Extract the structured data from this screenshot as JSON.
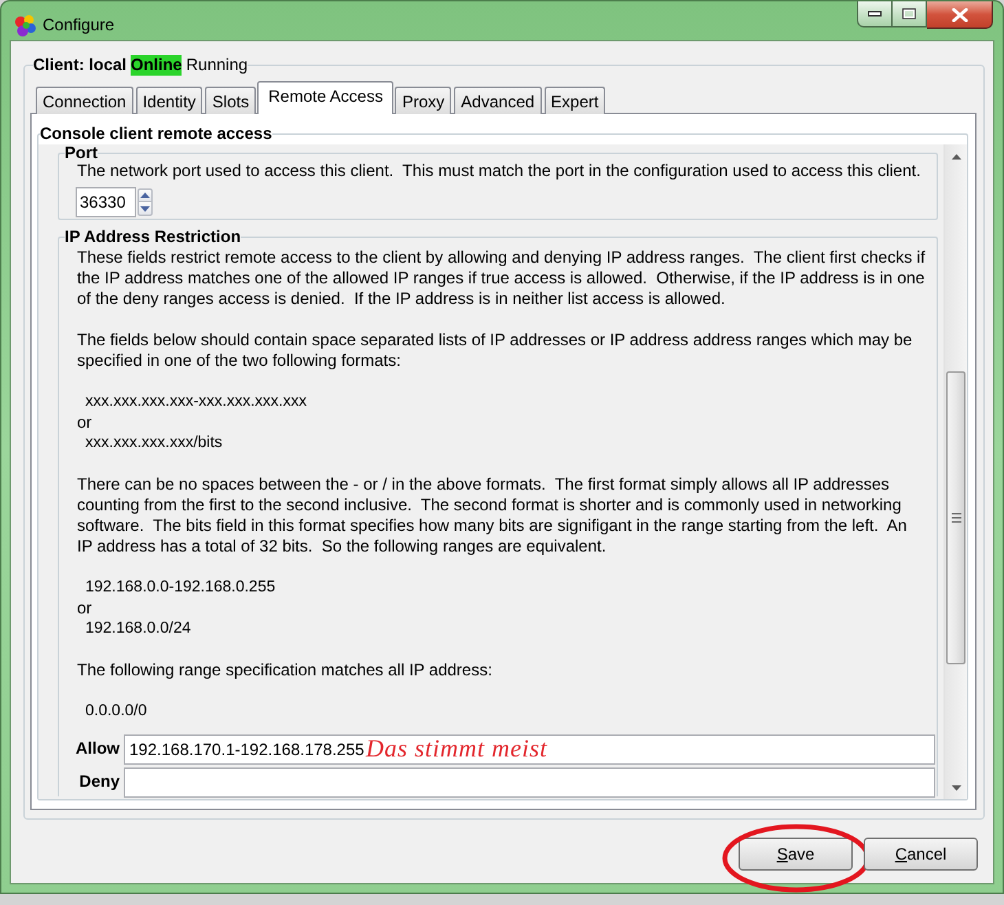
{
  "window": {
    "title": "Configure"
  },
  "client": {
    "label": "Client: local",
    "status": "Online",
    "online": true,
    "state": "Running"
  },
  "tabs": [
    {
      "label": "Connection",
      "selected": false
    },
    {
      "label": "Identity",
      "selected": false
    },
    {
      "label": "Slots",
      "selected": false
    },
    {
      "label": "Remote Access",
      "selected": true
    },
    {
      "label": "Proxy",
      "selected": false
    },
    {
      "label": "Advanced",
      "selected": false
    },
    {
      "label": "Expert",
      "selected": false
    }
  ],
  "remote_access": {
    "legend": "Console client remote access",
    "port": {
      "legend": "Port",
      "description": "The network port used to access this client.  This must match the port in the configuration used to access this client.",
      "value": "36330"
    },
    "ip_restriction": {
      "legend": "IP Address Restriction",
      "blocks": [
        {
          "kind": "paragraph",
          "text": "These fields restrict remote access to the client by allowing and denying IP address ranges.  The client first checks if the IP address matches one of the allowed IP ranges if true access is allowed.  Otherwise, if the IP address is in one  of the deny ranges access is denied.  If the IP address is in neither list access is allowed."
        },
        {
          "kind": "paragraph",
          "text": "The fields below should contain space separated lists of IP addresses or IP address address ranges which may be specified in one of the two following formats:"
        },
        {
          "kind": "formats",
          "lines": [
            {
              "kind": "example",
              "text": "xxx.xxx.xxx.xxx-xxx.xxx.xxx.xxx"
            },
            {
              "kind": "conjunction",
              "text": "or"
            },
            {
              "kind": "example",
              "text": "xxx.xxx.xxx.xxx/bits"
            }
          ]
        },
        {
          "kind": "paragraph",
          "text": "There can be no spaces between the - or / in the above formats.  The first format simply allows all IP addresses counting from the first to the second inclusive.  The second format is shorter and is commonly used in networking software.  The bits field in this format specifies how many bits are signifigant in the range starting from the left.  An IP address has a total of 32 bits.  So the following ranges are equivalent."
        },
        {
          "kind": "formats",
          "lines": [
            {
              "kind": "example",
              "text": "192.168.0.0-192.168.0.255"
            },
            {
              "kind": "conjunction",
              "text": "or"
            },
            {
              "kind": "example",
              "text": "192.168.0.0/24"
            }
          ]
        },
        {
          "kind": "paragraph",
          "text": "The following range specification matches all IP address:"
        },
        {
          "kind": "formats",
          "lines": [
            {
              "kind": "example",
              "text": "0.0.0.0/0"
            }
          ]
        }
      ],
      "fields": [
        {
          "label": "Allow",
          "value": "192.168.170.1-192.168.178.255",
          "annotation": "Das stimmt meist"
        },
        {
          "label": "Deny"
        }
      ]
    }
  },
  "buttons": [
    {
      "label": "Save",
      "highlighted": true
    },
    {
      "label": "Cancel",
      "highlighted": false
    }
  ]
}
